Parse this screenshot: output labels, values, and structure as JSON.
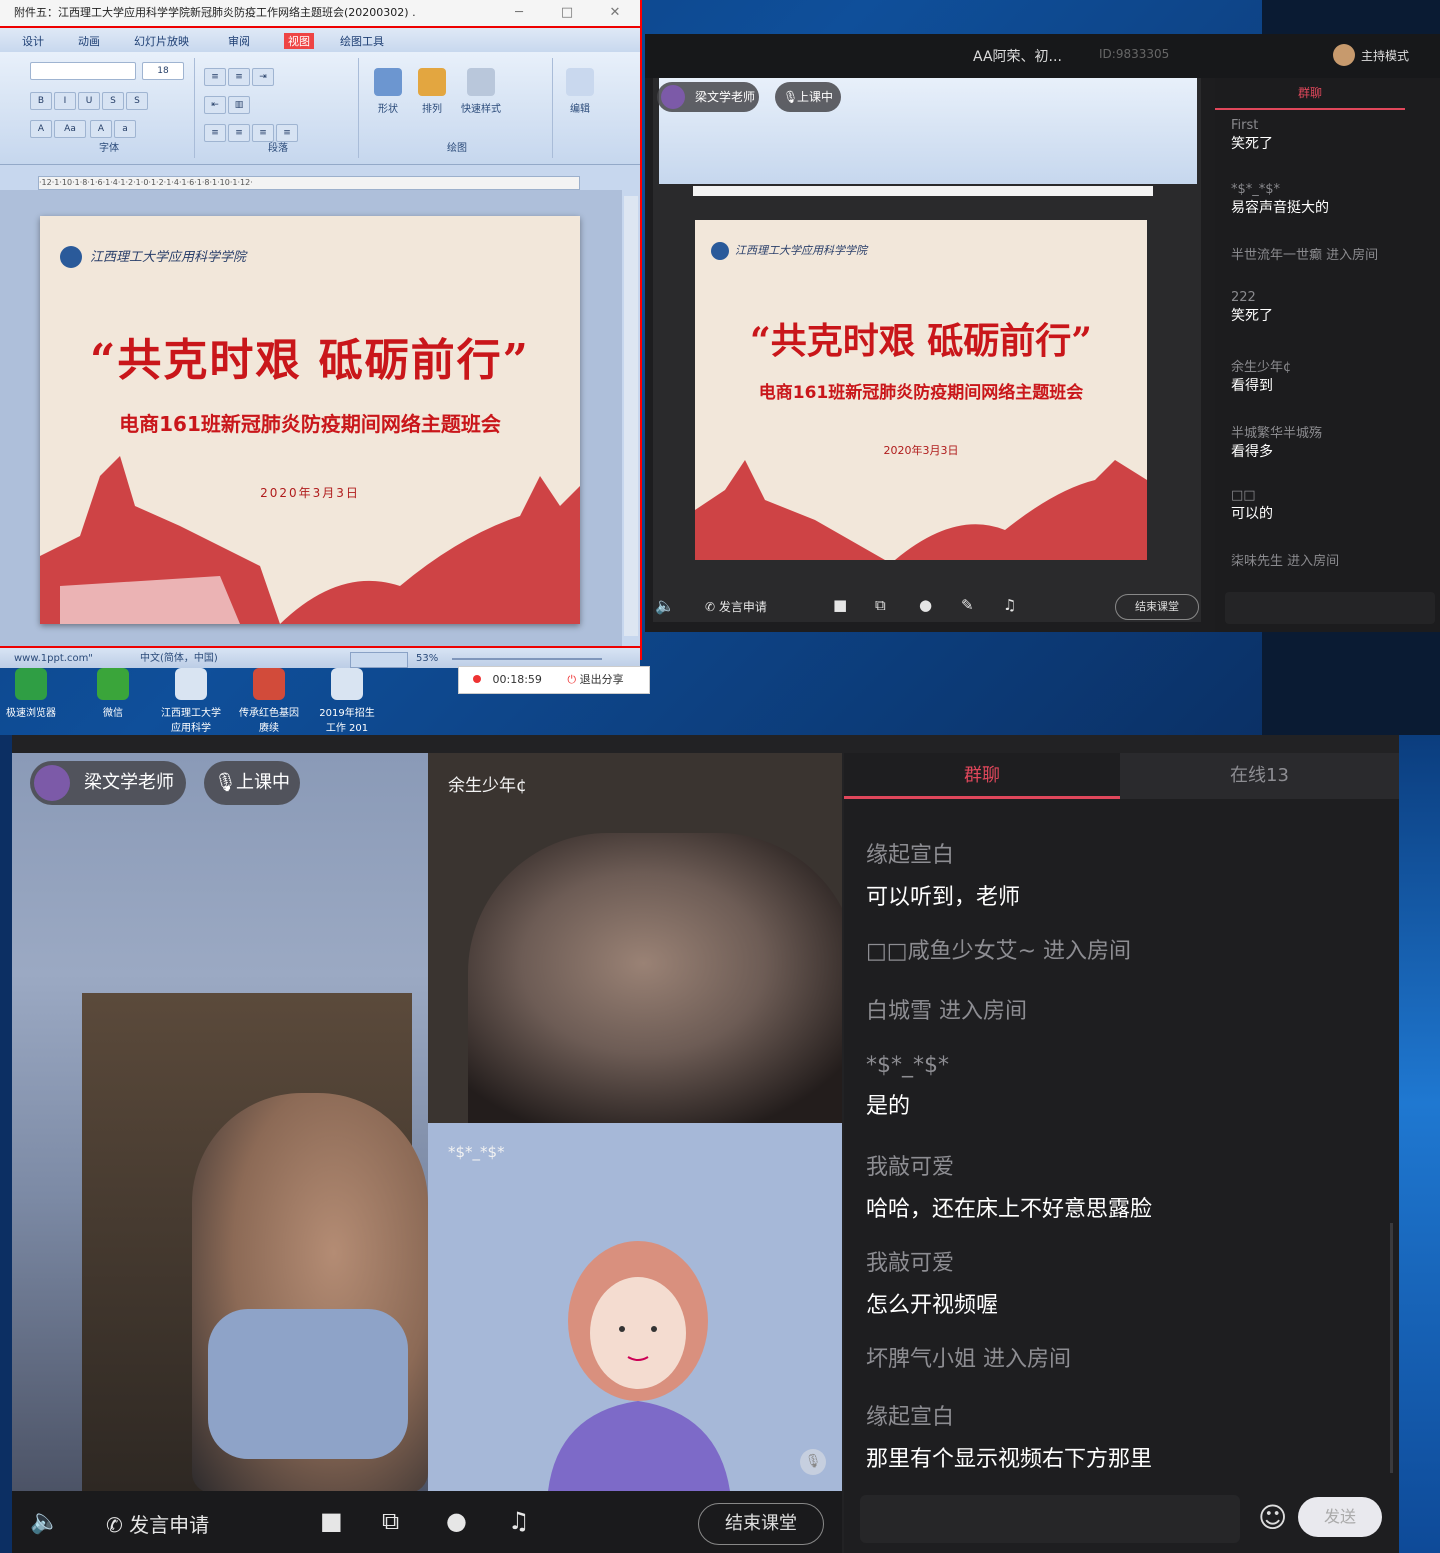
{
  "ppt": {
    "title": "附件五：江西理工大学应用科学学院新冠肺炎防疫工作网络主题班会(20200302) .",
    "tabs": [
      "设计",
      "动画",
      "幻灯片放映",
      "审阅",
      "视图",
      "绘图工具"
    ],
    "groups": [
      "字体",
      "段落",
      "绘图",
      "编辑"
    ],
    "ribbon_buttons": [
      "形状",
      "排列",
      "快速样式",
      "编辑"
    ],
    "ruler": "·12·1·10·1·8·1·6·1·4·1·2·1·0·1·2·1·4·1·6·1·8·1·10·1·12·",
    "status_left": "www.1ppt.com\"",
    "status_lang": "中文(简体，中国)",
    "zoom": "53%",
    "record_time": "00:18:59",
    "stop_share": "退出分享"
  },
  "slide": {
    "university": "江西理工大学应用科学学院",
    "title": "“共克时艰  砥砺前行”",
    "subtitle": "电商161班新冠肺炎防疫期间网络主题班会",
    "date": "2020年3月3日"
  },
  "taskbar": [
    {
      "label": "极速浏览器",
      "color": "#2f9e44"
    },
    {
      "label": "微信",
      "color": "#3aa53a"
    },
    {
      "label": "江西理工大学应用科学",
      "color": "#d9e4f2"
    },
    {
      "label": "传承红色基因 赓续",
      "color": "#d24b3a"
    },
    {
      "label": "2019年招生工作 201",
      "color": "#d9e4f2"
    }
  ],
  "live_top": {
    "room_title": "AA阿荣、初...",
    "room_id": "ID:9833305",
    "mode": "主持模式",
    "teacher_pill": "梁文学老师",
    "status_pill": "上课中",
    "chat_tab": "群聊",
    "apply_speak": "发言申请",
    "end_class": "结束课堂",
    "messages": [
      {
        "name": "First",
        "text": "笑死了"
      },
      {
        "name": "*$*_*$*",
        "text": "易容声音挺大的"
      },
      {
        "name": "",
        "text": "半世流年一世癫 进入房间"
      },
      {
        "name": "222",
        "text": "笑死了"
      },
      {
        "name": "余生少年¢",
        "text": "看得到"
      },
      {
        "name": "半城繁华半城殇",
        "text": "看得多"
      },
      {
        "name": "□□",
        "text": "可以的"
      },
      {
        "name": "",
        "text": "柒味先生 进入房间"
      }
    ]
  },
  "main": {
    "teacher_name": "梁文学老师",
    "status": "上课中",
    "student1": "余生少年¢",
    "student2": "*$*_*$*",
    "apply_speak": "发言申请",
    "end_class": "结束课堂",
    "send": "发送",
    "tabs": {
      "chat": "群聊",
      "online": "在线13"
    },
    "accent": "#e0475b",
    "messages": [
      {
        "name": "缘起宣白",
        "text": "可以听到，老师"
      },
      {
        "name": "",
        "text": "□□咸鱼少女艾~ 进入房间"
      },
      {
        "name": "",
        "text": "白城雪 进入房间"
      },
      {
        "name": "*$*_*$*",
        "text": "是的"
      },
      {
        "name": "我敲可爱",
        "text": "哈哈，还在床上不好意思露脸"
      },
      {
        "name": "我敲可爱",
        "text": "怎么开视频喔"
      },
      {
        "name": "",
        "text": "坏脾气小姐 进入房间"
      },
      {
        "name": "缘起宣白",
        "text": "那里有个显示视频右下方那里"
      }
    ]
  }
}
